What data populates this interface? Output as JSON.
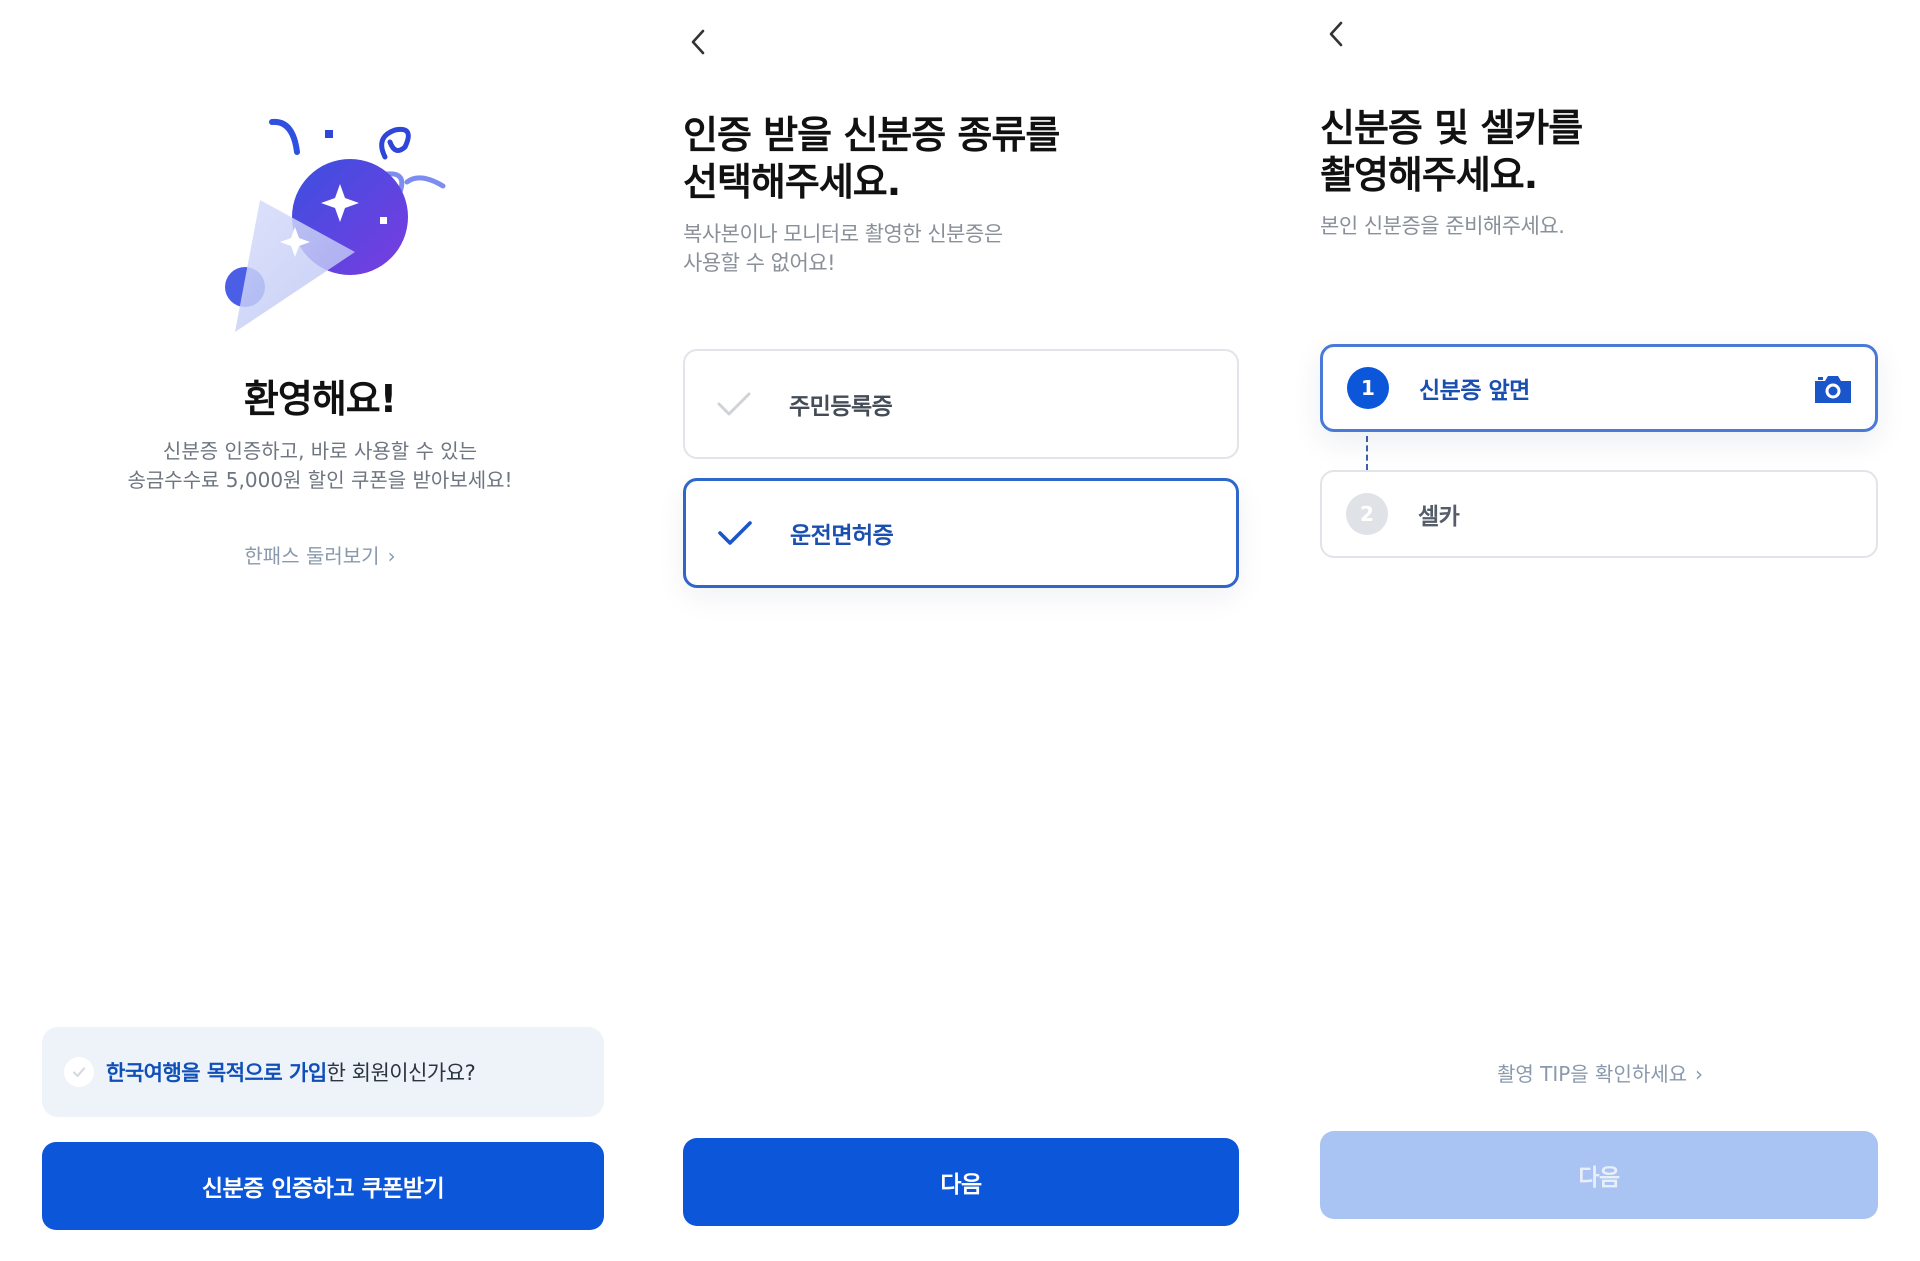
{
  "screen1": {
    "title": "환영해요!",
    "description_line1": "신분증 인증하고, 바로 사용할 수 있는",
    "description_line2": "송금수수료 5,000원 할인 쿠폰을 받아보세요!",
    "tour_link": "한패스 둘러보기",
    "notice": {
      "highlight": "한국여행을 목적으로 가입",
      "rest": "한 회원이신가요?",
      "checked": false
    },
    "cta_label": "신분증 인증하고 쿠폰받기"
  },
  "screen2": {
    "title_line1": "인증 받을 신분증 종류를",
    "title_line2": "선택해주세요.",
    "subtitle_line1": "복사본이나 모니터로 촬영한 신분증은",
    "subtitle_line2": "사용할 수 없어요!",
    "options": [
      {
        "label": "주민등록증",
        "selected": false
      },
      {
        "label": "운전면허증",
        "selected": true
      }
    ],
    "next_label": "다음"
  },
  "screen3": {
    "title_line1": "신분증 및 셀카를",
    "title_line2": "촬영해주세요.",
    "subtitle": "본인 신분증을 준비해주세요.",
    "steps": [
      {
        "number": "1",
        "label": "신분증 앞면",
        "active": true,
        "icon": "camera-icon"
      },
      {
        "number": "2",
        "label": "셀카",
        "active": false
      }
    ],
    "tip_link": "촬영 TIP을 확인하세요",
    "next_label": "다음",
    "next_enabled": false
  },
  "colors": {
    "primary": "#0c56da",
    "primary_disabled": "#a9c4f2",
    "selected_text": "#1a4fb0",
    "muted_text": "#8a99ac",
    "notice_bg": "#eef3fa"
  }
}
